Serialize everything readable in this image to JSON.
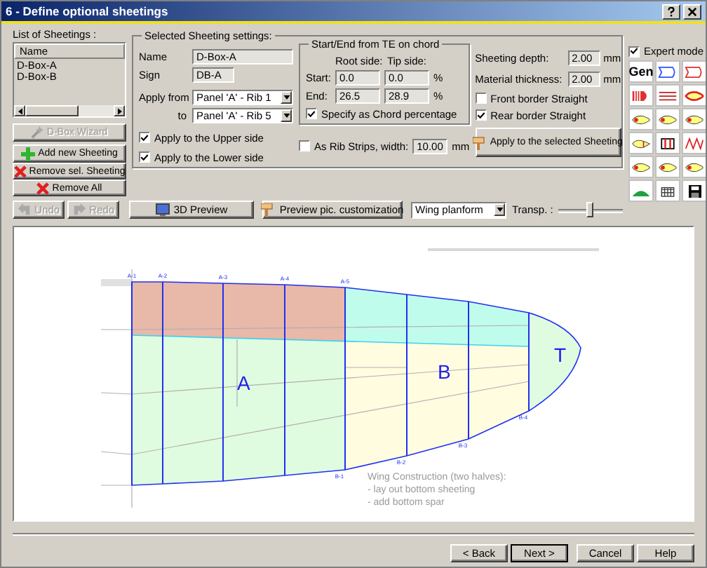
{
  "window": {
    "title": "6 - Define optional sheetings"
  },
  "sheetings_list": {
    "label": "List of Sheetings :",
    "column": "Name",
    "items": [
      {
        "name": "D-Box-A",
        "selected": false
      },
      {
        "name": "D-Box-B",
        "selected": false
      }
    ]
  },
  "list_buttons": [
    {
      "label": "D-Box Wizard",
      "kind": "wand",
      "disabled": true
    },
    {
      "label": "Add new Sheeting",
      "kind": "add",
      "disabled": false
    },
    {
      "label": "Remove sel. Sheeting",
      "kind": "remove",
      "disabled": false
    },
    {
      "label": "Remove All",
      "kind": "remove",
      "disabled": false
    }
  ],
  "settings": {
    "title": "Selected Sheeting settings:",
    "name_label": "Name",
    "name_value": "D-Box-A",
    "sign_label": "Sign",
    "sign_value": "DB-A",
    "apply_from_label": "Apply from",
    "apply_from_value": "Panel 'A' - Rib 1",
    "to_label": "to",
    "to_value": "Panel 'A' - Rib 5",
    "sides": [
      {
        "label": "Apply to the Upper side",
        "checked": true
      },
      {
        "label": "Apply to the Lower side",
        "checked": true
      }
    ]
  },
  "start_end": {
    "title": "Start/End from TE on chord",
    "root_header": "Root side:",
    "tip_header": "Tip side:",
    "rows": [
      {
        "label": "Start:",
        "root": "0.0",
        "tip": "0.0",
        "unit": "%"
      },
      {
        "label": "End:",
        "root": "26.5",
        "tip": "28.9",
        "unit": "%"
      }
    ],
    "chord_percentage": {
      "label": "Specify as Chord percentage",
      "checked": true
    }
  },
  "rib_strips": {
    "label": "As Rib Strips, width:",
    "checked": false,
    "value": "10.00",
    "unit": "mm"
  },
  "measures": [
    {
      "label": "Sheeting depth:",
      "value": "2.00",
      "unit": "mm"
    },
    {
      "label": "Material thickness:",
      "value": "2.00",
      "unit": "mm"
    }
  ],
  "borders": [
    {
      "label": "Front border Straight",
      "checked": false
    },
    {
      "label": "Rear border Straight",
      "checked": true
    }
  ],
  "apply_button": "Apply to the selected Sheeting",
  "expert_mode": {
    "label": "Expert mode",
    "checked": true
  },
  "tools": [
    {
      "kind": "text",
      "label": "Gen"
    },
    {
      "kind": "outline"
    },
    {
      "kind": "nose"
    },
    {
      "kind": "ribs"
    },
    {
      "kind": "panel"
    },
    {
      "kind": "sheet"
    },
    {
      "kind": "airfoil"
    },
    {
      "kind": "airfoil"
    },
    {
      "kind": "airfoil"
    },
    {
      "kind": "slot"
    },
    {
      "kind": "deck"
    },
    {
      "kind": "zigzag"
    },
    {
      "kind": "airfoil"
    },
    {
      "kind": "airfoil"
    },
    {
      "kind": "airfoil"
    },
    {
      "kind": "tip"
    },
    {
      "kind": "pattern"
    },
    {
      "kind": "save"
    }
  ],
  "history_buttons": [
    {
      "label": "Undo",
      "kind": "undo",
      "disabled": true
    },
    {
      "label": "Redo",
      "kind": "redo",
      "disabled": true
    }
  ],
  "preview_buttons": [
    {
      "label": "3D Preview",
      "kind": "monitor"
    },
    {
      "label": "Preview pic. customization",
      "kind": "brush"
    }
  ],
  "view_select": {
    "value": "Wing planform"
  },
  "transparency": {
    "label": "Transp. :",
    "level": 0.5
  },
  "planform": {
    "top_labels": [
      "A-1",
      "A-2",
      "A-3",
      "A-4",
      "A-5"
    ],
    "bottom_labels": [
      "B-1",
      "B-2",
      "B-3",
      "B-4"
    ],
    "panels": [
      "A",
      "B",
      "T"
    ],
    "caption": [
      "Wing Construction (two halves):",
      "- lay out bottom sheeting",
      "- add bottom spar"
    ]
  },
  "footer_buttons": [
    {
      "label": "< Back",
      "default": false
    },
    {
      "label": "Next >",
      "default": true
    },
    {
      "label": "Cancel",
      "default": false
    },
    {
      "label": "Help",
      "default": false
    }
  ]
}
